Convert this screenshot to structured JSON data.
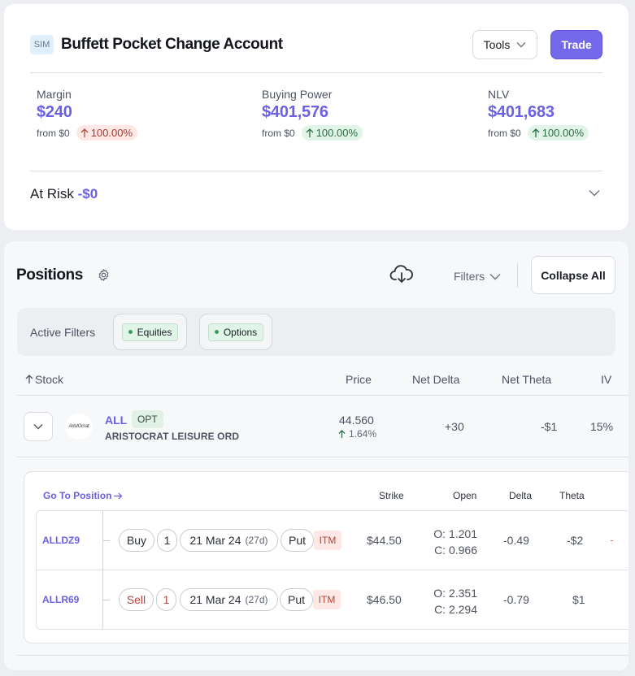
{
  "account": {
    "sim_label": "SIM",
    "title": "Buffett Pocket Change Account",
    "tools_label": "Tools",
    "trade_label": "Trade",
    "metrics": [
      {
        "label": "Margin",
        "value": "$240",
        "from": "from $0",
        "change": "100.00%",
        "trend": "up-red"
      },
      {
        "label": "Buying Power",
        "value": "$401,576",
        "from": "from $0",
        "change": "100.00%",
        "trend": "up-green"
      },
      {
        "label": "NLV",
        "value": "$401,683",
        "from": "from $0",
        "change": "100.00%",
        "trend": "up-green"
      }
    ],
    "at_risk_label": "At Risk",
    "at_risk_value": "-$0"
  },
  "positions": {
    "title": "Positions",
    "filters_label": "Filters",
    "collapse_label": "Collapse All",
    "active_filters_label": "Active Filters",
    "active_filters": [
      "Equities",
      "Options"
    ],
    "columns": {
      "stock": "Stock",
      "price": "Price",
      "net_delta": "Net Delta",
      "net_theta": "Net Theta",
      "iv": "IV"
    },
    "row": {
      "logo_text": "AristOcrat",
      "ticker": "ALL",
      "badge": "OPT",
      "company": "ARISTOCRAT LEISURE ORD",
      "price": "44.560",
      "price_change": "1.64%",
      "net_delta": "+30",
      "net_theta": "-$1",
      "iv": "15%"
    },
    "detail": {
      "goto_label": "Go To Position",
      "columns": {
        "strike": "Strike",
        "open": "Open",
        "delta": "Delta",
        "theta": "Theta"
      },
      "legs": [
        {
          "symbol": "ALLDZ9",
          "side": "Buy",
          "qty": "1",
          "expiry": "21 Mar 24",
          "dte": "(27d)",
          "type": "Put",
          "itm": "ITM",
          "strike": "$44.50",
          "open_o": "O: 1.201",
          "open_c": "C: 0.966",
          "delta": "-0.49",
          "theta": "-$2"
        },
        {
          "symbol": "ALLR69",
          "side": "Sell",
          "qty": "1",
          "expiry": "21 Mar 24",
          "dte": "(27d)",
          "type": "Put",
          "itm": "ITM",
          "strike": "$46.50",
          "open_o": "O: 2.351",
          "open_c": "C: 2.294",
          "delta": "-0.79",
          "theta": "$1"
        }
      ]
    }
  },
  "colors": {
    "accent": "#6a60e4",
    "trade_button": "#7469ea",
    "positive": "#2c6b43",
    "negative": "#a33a30"
  },
  "icons": [
    "chevron-down-icon",
    "arrow-up-icon",
    "gear-icon",
    "cloud-download-icon",
    "sort-arrow-up-icon",
    "arrow-right-icon"
  ]
}
